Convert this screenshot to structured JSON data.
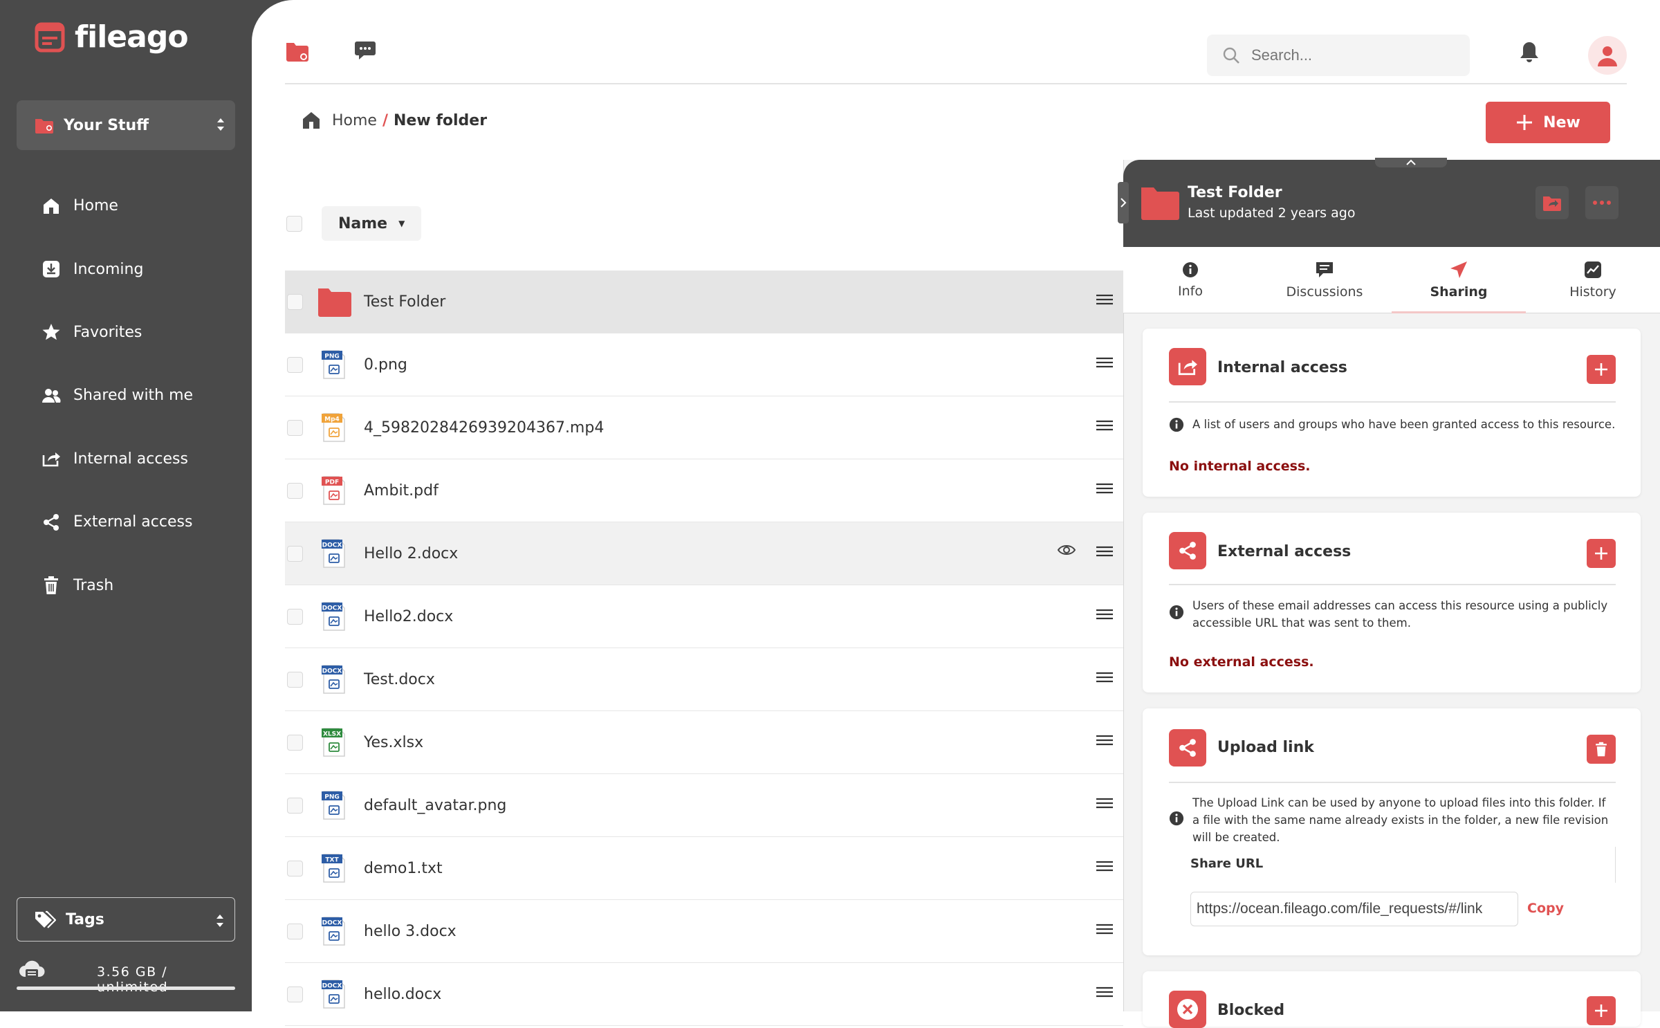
{
  "app": {
    "logo_text": "fileago"
  },
  "colors": {
    "accent": "#e05252",
    "sidebar": "#4a4a4a",
    "danger_text": "#8b0f0f"
  },
  "sidebar": {
    "workspace_label": "Your Stuff",
    "items": [
      {
        "label": "Home",
        "icon": "home-icon"
      },
      {
        "label": "Incoming",
        "icon": "incoming-icon"
      },
      {
        "label": "Favorites",
        "icon": "star-icon"
      },
      {
        "label": "Shared with me",
        "icon": "users-icon"
      },
      {
        "label": "Internal access",
        "icon": "share-box-icon"
      },
      {
        "label": "External access",
        "icon": "share-nodes-icon"
      },
      {
        "label": "Trash",
        "icon": "trash-icon"
      }
    ],
    "tags_label": "Tags",
    "storage_text": "3.56 GB / unlimited"
  },
  "topbar": {
    "search_placeholder": "Search..."
  },
  "breadcrumb": {
    "home": "Home",
    "separator": "/",
    "current": "New folder"
  },
  "toolbar": {
    "new_label": "New"
  },
  "list": {
    "sort_label": "Name",
    "files": [
      {
        "name": "Test Folder",
        "type": "folder"
      },
      {
        "name": "0.png",
        "type": "PNG"
      },
      {
        "name": "4_5982028426939204367.mp4",
        "type": "Mp4"
      },
      {
        "name": "Ambit.pdf",
        "type": "PDF"
      },
      {
        "name": "Hello 2.docx",
        "type": "DOCX"
      },
      {
        "name": "Hello2.docx",
        "type": "DOCX"
      },
      {
        "name": "Test.docx",
        "type": "DOCX"
      },
      {
        "name": "Yes.xlsx",
        "type": "XLSX"
      },
      {
        "name": "default_avatar.png",
        "type": "PNG"
      },
      {
        "name": "demo1.txt",
        "type": "TXT"
      },
      {
        "name": "hello 3.docx",
        "type": "DOCX"
      },
      {
        "name": "hello.docx",
        "type": "DOCX"
      }
    ]
  },
  "details": {
    "title": "Test Folder",
    "subtitle": "Last updated 2 years ago",
    "tabs": [
      {
        "label": "Info",
        "icon": "info-icon"
      },
      {
        "label": "Discussions",
        "icon": "discussions-icon"
      },
      {
        "label": "Sharing",
        "icon": "send-icon"
      },
      {
        "label": "History",
        "icon": "history-icon"
      }
    ],
    "internal": {
      "title": "Internal access",
      "desc": "A list of users and groups who have been granted access to this resource.",
      "empty": "No internal access."
    },
    "external": {
      "title": "External access",
      "desc": "Users of these email addresses can access this resource using a publicly accessible URL that was sent to them.",
      "empty": "No external access."
    },
    "upload": {
      "title": "Upload link",
      "desc": "The Upload Link can be used by anyone to upload files into this folder. If a file with the same name already exists in the folder, a new file revision will be created.",
      "share_url_label": "Share URL",
      "share_url_value": "https://ocean.fileago.com/file_requests/#/link",
      "copy_label": "Copy"
    },
    "blocked": {
      "title": "Blocked"
    }
  }
}
